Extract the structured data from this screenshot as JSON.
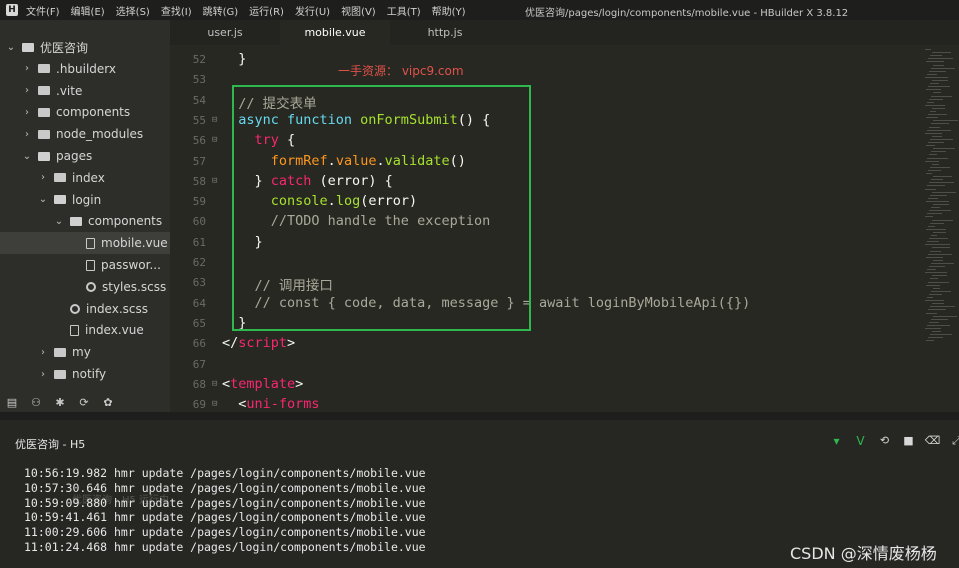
{
  "window": {
    "title": "优医咨询/pages/login/components/mobile.vue - HBuilder X 3.8.12",
    "logo": "H",
    "menu": [
      "文件(F)",
      "编辑(E)",
      "选择(S)",
      "查找(I)",
      "跳转(G)",
      "运行(R)",
      "发行(U)",
      "视图(V)",
      "工具(T)",
      "帮助(Y)"
    ]
  },
  "tabs": [
    "user.js",
    "mobile.vue",
    "http.js"
  ],
  "sidebar": {
    "items": [
      {
        "label": "优医咨询",
        "kind": "project",
        "depth": 0,
        "chevron": "down"
      },
      {
        "label": ".hbuilderx",
        "kind": "folder",
        "depth": 1,
        "chevron": "right"
      },
      {
        "label": ".vite",
        "kind": "folder",
        "depth": 1,
        "chevron": "right"
      },
      {
        "label": "components",
        "kind": "folder",
        "depth": 1,
        "chevron": "right"
      },
      {
        "label": "node_modules",
        "kind": "folder",
        "depth": 1,
        "chevron": "right"
      },
      {
        "label": "pages",
        "kind": "folder-open",
        "depth": 1,
        "chevron": "down"
      },
      {
        "label": "index",
        "kind": "folder",
        "depth": 2,
        "chevron": "right"
      },
      {
        "label": "login",
        "kind": "folder-open",
        "depth": 2,
        "chevron": "down"
      },
      {
        "label": "components",
        "kind": "folder-open",
        "depth": 3,
        "chevron": "down"
      },
      {
        "label": "mobile.vue",
        "kind": "file",
        "depth": 4,
        "chevron": "",
        "selected": true
      },
      {
        "label": "passwor...",
        "kind": "file",
        "depth": 4,
        "chevron": ""
      },
      {
        "label": "styles.scss",
        "kind": "gear",
        "depth": 4,
        "chevron": ""
      },
      {
        "label": "index.scss",
        "kind": "gear",
        "depth": 3,
        "chevron": ""
      },
      {
        "label": "index.vue",
        "kind": "file",
        "depth": 3,
        "chevron": ""
      },
      {
        "label": "my",
        "kind": "folder",
        "depth": 2,
        "chevron": "right"
      },
      {
        "label": "notify",
        "kind": "folder",
        "depth": 2,
        "chevron": "right"
      }
    ],
    "tool_icons": [
      "explorer-icon",
      "debug-icon",
      "bug-icon",
      "git-icon",
      "plugin-icon"
    ]
  },
  "editor": {
    "watermark": "一手资源：  vipc9.com",
    "lines": [
      {
        "n": "52",
        "fold": "",
        "tokens": [
          [
            "plain",
            "  }"
          ]
        ]
      },
      {
        "n": "53",
        "fold": "",
        "tokens": []
      },
      {
        "n": "54",
        "fold": "",
        "tokens": [
          [
            "cm",
            "  // 提交表单"
          ]
        ]
      },
      {
        "n": "55",
        "fold": "⊟",
        "tokens": [
          [
            "kwb",
            "  async function "
          ],
          [
            "fn",
            "onFormSubmit"
          ],
          [
            "plain",
            "() {"
          ]
        ]
      },
      {
        "n": "56",
        "fold": "⊟",
        "tokens": [
          [
            "kw",
            "    try"
          ],
          [
            "plain",
            " {"
          ]
        ]
      },
      {
        "n": "57",
        "fold": "",
        "tokens": [
          [
            "prop",
            "      formRef"
          ],
          [
            "plain",
            "."
          ],
          [
            "prop",
            "value"
          ],
          [
            "plain",
            "."
          ],
          [
            "fn",
            "validate"
          ],
          [
            "plain",
            "()"
          ]
        ]
      },
      {
        "n": "58",
        "fold": "⊟",
        "tokens": [
          [
            "plain",
            "    } "
          ],
          [
            "kw",
            "catch"
          ],
          [
            "plain",
            " (error) {"
          ]
        ]
      },
      {
        "n": "59",
        "fold": "",
        "tokens": [
          [
            "fn",
            "      console"
          ],
          [
            "plain",
            "."
          ],
          [
            "fn",
            "log"
          ],
          [
            "plain",
            "(error)"
          ]
        ]
      },
      {
        "n": "60",
        "fold": "",
        "tokens": [
          [
            "cm",
            "      //TODO handle the exception"
          ]
        ]
      },
      {
        "n": "61",
        "fold": "",
        "tokens": [
          [
            "plain",
            "    }"
          ]
        ]
      },
      {
        "n": "62",
        "fold": "",
        "tokens": []
      },
      {
        "n": "63",
        "fold": "",
        "tokens": [
          [
            "cm",
            "    // 调用接口"
          ]
        ]
      },
      {
        "n": "64",
        "fold": "",
        "tokens": [
          [
            "cm",
            "    // const { code, data, message } = await loginByMobileApi({})"
          ]
        ]
      },
      {
        "n": "65",
        "fold": "",
        "tokens": [
          [
            "plain",
            "  }"
          ]
        ]
      },
      {
        "n": "66",
        "fold": "",
        "tokens": [
          [
            "plain",
            "</"
          ],
          [
            "tag",
            "script"
          ],
          [
            "plain",
            ">"
          ]
        ]
      },
      {
        "n": "67",
        "fold": "",
        "tokens": []
      },
      {
        "n": "68",
        "fold": "⊟",
        "tokens": [
          [
            "plain",
            "<"
          ],
          [
            "tag",
            "template"
          ],
          [
            "plain",
            ">"
          ]
        ]
      },
      {
        "n": "69",
        "fold": "⊟",
        "tokens": [
          [
            "plain",
            "  <"
          ],
          [
            "tag",
            "uni-forms"
          ]
        ]
      }
    ]
  },
  "console": {
    "title": "优医咨询 - H5",
    "tool_icons": [
      "chevron-down-icon",
      "vue-icon",
      "restart-icon",
      "stop-icon",
      "clear-icon",
      "expand-icon"
    ],
    "ghost_text": "优医咨询 - H5 运行中",
    "logs": [
      "10:56:19.982 hmr update /pages/login/components/mobile.vue",
      "10:57:30.646 hmr update /pages/login/components/mobile.vue",
      "10:59:09.880 hmr update /pages/login/components/mobile.vue",
      "10:59:41.461 hmr update /pages/login/components/mobile.vue",
      "11:00:29.606 hmr update /pages/login/components/mobile.vue",
      "11:01:24.468 hmr update /pages/login/components/mobile.vue"
    ]
  },
  "csdn_watermark": "CSDN @深情废杨杨",
  "colors": {
    "background": "#272822",
    "highlight_box": "#2fb84e",
    "keyword": "#f92672",
    "function": "#a6e22e",
    "property": "#fd971f",
    "comment": "#a9a99a",
    "watermark": "#e0524a"
  }
}
